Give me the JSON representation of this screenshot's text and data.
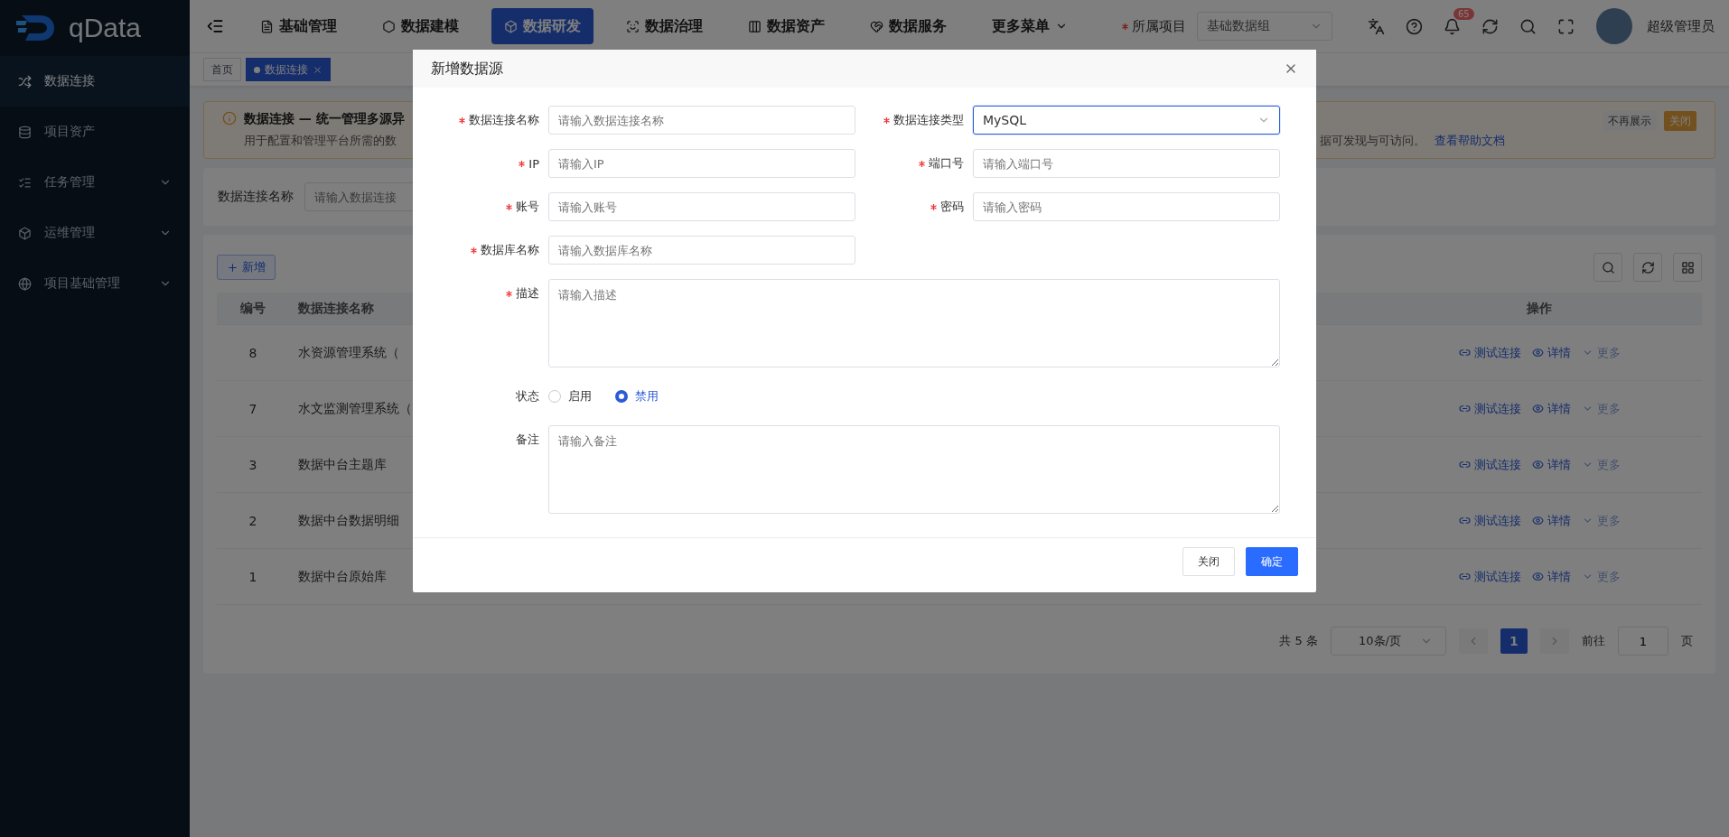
{
  "sidebar": {
    "logo": "qData",
    "items": [
      {
        "label": "数据连接",
        "selected": true,
        "expandable": false
      },
      {
        "label": "项目资产",
        "selected": false,
        "expandable": false
      },
      {
        "label": "任务管理",
        "selected": false,
        "expandable": true
      },
      {
        "label": "运维管理",
        "selected": false,
        "expandable": true
      },
      {
        "label": "项目基础管理",
        "selected": false,
        "expandable": true
      }
    ]
  },
  "topbar": {
    "nav": [
      {
        "label": "基础管理",
        "selected": false
      },
      {
        "label": "数据建模",
        "selected": false
      },
      {
        "label": "数据研发",
        "selected": true
      },
      {
        "label": "数据治理",
        "selected": false
      },
      {
        "label": "数据资产",
        "selected": false
      },
      {
        "label": "数据服务",
        "selected": false
      }
    ],
    "more": "更多菜单",
    "project_label": "所属项目",
    "project_required": true,
    "project_value": "基础数据组",
    "notification_count": "65",
    "user": "超级管理员"
  },
  "tabs": [
    {
      "label": "首页",
      "selected": false
    },
    {
      "label": "数据连接",
      "selected": true
    }
  ],
  "alert": {
    "title": "数据连接 — 统一管理多源异",
    "description_start": "用于配置和管理平台所需的数",
    "description_end": "据可发现与可访问。",
    "link": "查看帮助文档",
    "buttons": [
      {
        "label": "不再展示",
        "kind": "plain"
      },
      {
        "label": "关闭",
        "kind": "warning"
      }
    ]
  },
  "filter": {
    "label": "数据连接名称",
    "placeholder": "请输入数据连接"
  },
  "table": {
    "add_button": "新增",
    "columns": [
      "编号",
      "数据连接名称",
      "操作"
    ],
    "rows": [
      {
        "id": "8",
        "name": "水资源管理系统（",
        "actions": [
          {
            "label": "测试连接",
            "kind": "test"
          },
          {
            "label": "详情",
            "kind": "detail"
          },
          {
            "label": "更多",
            "kind": "more"
          }
        ]
      },
      {
        "id": "7",
        "name": "水文监测管理系统（",
        "actions": [
          {
            "label": "测试连接",
            "kind": "test"
          },
          {
            "label": "详情",
            "kind": "detail"
          },
          {
            "label": "更多",
            "kind": "more"
          }
        ]
      },
      {
        "id": "3",
        "name": "数据中台主题库",
        "actions": [
          {
            "label": "测试连接",
            "kind": "test"
          },
          {
            "label": "详情",
            "kind": "detail"
          },
          {
            "label": "更多",
            "kind": "more"
          }
        ]
      },
      {
        "id": "2",
        "name": "数据中台数据明细",
        "actions": [
          {
            "label": "测试连接",
            "kind": "test"
          },
          {
            "label": "详情",
            "kind": "detail"
          },
          {
            "label": "更多",
            "kind": "more"
          }
        ]
      },
      {
        "id": "1",
        "name": "数据中台原始库",
        "actions": [
          {
            "label": "测试连接",
            "kind": "test"
          },
          {
            "label": "详情",
            "kind": "detail"
          },
          {
            "label": "更多",
            "kind": "more"
          }
        ]
      }
    ]
  },
  "pagination": {
    "total": "共 5 条",
    "page_size": "10条/页",
    "pages": [
      {
        "label": "1",
        "selected": true
      }
    ],
    "goto_label": "前往",
    "goto_value": "1",
    "goto_suffix": "页"
  },
  "modal": {
    "title": "新增数据源",
    "fields": [
      {
        "label": "数据连接名称",
        "kind": "input",
        "required": true,
        "focused": false,
        "placeholder": "请输入数据连接名称"
      },
      {
        "label": "数据连接类型",
        "kind": "select",
        "required": true,
        "focused": true,
        "value": "MySQL"
      },
      {
        "label": "IP",
        "kind": "input",
        "required": true,
        "focused": false,
        "placeholder": "请输入IP"
      },
      {
        "label": "端口号",
        "kind": "input",
        "required": true,
        "focused": false,
        "placeholder": "请输入端口号"
      },
      {
        "label": "账号",
        "kind": "input",
        "required": true,
        "focused": false,
        "placeholder": "请输入账号"
      },
      {
        "label": "密码",
        "kind": "input",
        "required": true,
        "focused": false,
        "placeholder": "请输入密码"
      },
      {
        "label": "数据库名称",
        "kind": "input",
        "required": true,
        "focused": false,
        "placeholder": "请输入数据库名称"
      },
      {
        "label": "描述",
        "kind": "textarea",
        "required": true,
        "focused": false,
        "placeholder": "请输入描述"
      },
      {
        "label": "状态",
        "kind": "radio",
        "required": false,
        "options": [
          {
            "label": "启用",
            "selected": false
          },
          {
            "label": "禁用",
            "selected": true
          }
        ]
      },
      {
        "label": "备注",
        "kind": "textarea",
        "required": false,
        "focused": false,
        "placeholder": "请输入备注"
      }
    ],
    "buttons": [
      {
        "label": "关闭",
        "kind": "default"
      },
      {
        "label": "确定",
        "kind": "primary"
      }
    ]
  }
}
